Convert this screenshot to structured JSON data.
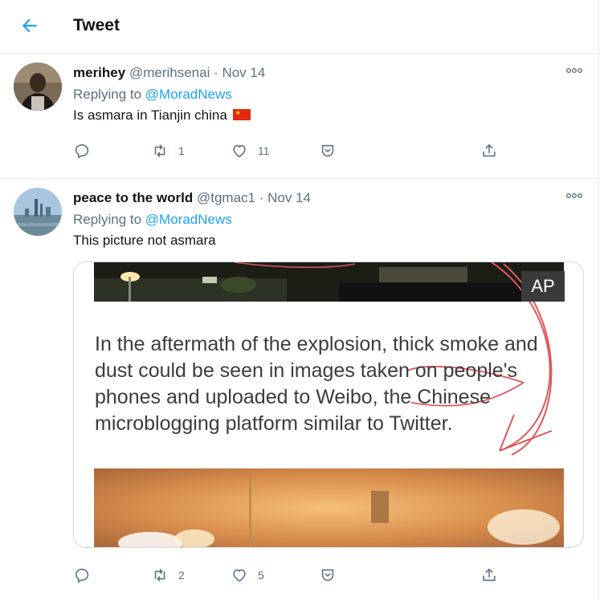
{
  "header": {
    "title": "Tweet",
    "back_icon": "arrow-left-icon",
    "accent": "#1da1f2"
  },
  "tweets": [
    {
      "name": "merihey",
      "handle": "@merihsenai · Nov 14",
      "replying_prefix": "Replying to ",
      "replying_to": "@MoradNews",
      "text": "Is asmara in Tianjin china",
      "emoji": "flag-china-icon",
      "replies": "",
      "retweets": "1",
      "likes": "11"
    },
    {
      "name": "peace to the world",
      "handle": "@tgmac1 · Nov 14",
      "replying_prefix": "Replying to ",
      "replying_to": "@MoradNews",
      "text": "This picture not asmara",
      "replies": "",
      "retweets": "2",
      "likes": "5",
      "media": {
        "watermark": "AP",
        "caption": "In the aftermath of the explosion, thick smoke and dust could be seen in images taken on people's phones and uploaded to Weibo, the Chinese microblogging platform similar to Twitter."
      }
    }
  ]
}
